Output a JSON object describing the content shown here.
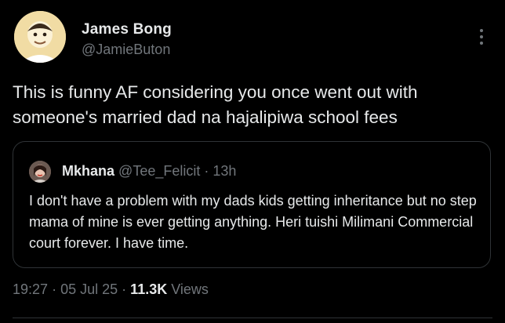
{
  "author": {
    "display_name": "James Bong",
    "handle": "@JamieButon",
    "avatar_icon": "profile-photo"
  },
  "more_icon": "more-vertical-icon",
  "tweet": {
    "text": "This is funny AF considering you once went out with someone's married dad na hajalipiwa school fees"
  },
  "quote": {
    "display_name": "Mkhana",
    "handle": "@Tee_Felicit",
    "separator": "·",
    "time": "13h",
    "text": "I don't have a problem with my dads kids getting inheritance but no step mama of mine is ever getting anything. Heri tuishi Milimani Commercial court forever. I have time."
  },
  "meta": {
    "time": "19:27",
    "sep1": "·",
    "date": "05 Jul 25",
    "sep2": "·",
    "views_count": "11.3K",
    "views_label": "Views"
  },
  "colors": {
    "background": "#000000",
    "primary_text": "#e7e9ea",
    "secondary_text": "#71767b",
    "border": "#2f3336"
  }
}
